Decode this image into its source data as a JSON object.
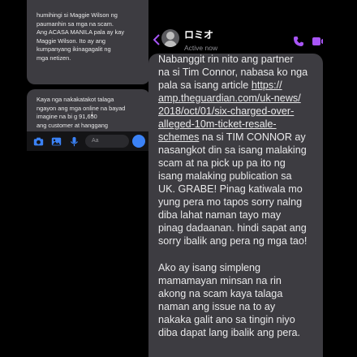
{
  "left_panel": {
    "message_top": "humihingi si Maggie Wilson ng\npaumanhin sa mga na scam.\nAng ACASA MANILA pala ay kay\nMaggie Wilson. Ito ay ang\nkumpanyang ikinagagalit ng\nmga netizen.",
    "message_bottom": "Kaya nga nakakatakot talaga\nngayon ang mga online na bayad\nimagine na bi    g 91,650\nang customer at hanggang",
    "composer_placeholder": "Aa"
  },
  "chat": {
    "contact_name": "ロミオ",
    "status": "Active now",
    "paragraph1_before_link": "Nabanggit rin nito ang partner\nna si Tim Connor, nabasa ko nga\npala sa isang article ",
    "paragraph1_link": "https://\namp.theguardian.com/uk-news/\n2018/oct/01/six-charged-over-\nalleged-10m-ticket-resale-\nschemes",
    "paragraph1_after_link": " na si TIM CONNOR ay\nnasangkot din sa isang malaking\nscam at na pick up pa ito ng\nisang malaking publication sa\nUK. GRABE! Pinag katiwala mo\nyung pera mo tapos sorry nalng\ndiba lahat naman tayo may\npinag dadaanan. hindi sapat ang\nsorry ibalik ang pera ng mga tao!",
    "paragraph2": "Ako ay isang simpleng\nmamamayan minsan na rin\nakong na scam kaya talaga\nnaman ang issue na to ay\nnakaka galit ano sa tingin niyo\ndiba dapat lang ibalik ang pera."
  },
  "colors": {
    "accent": "#a855f7",
    "composer_accent": "#3b82f6",
    "bubble": "#3d3c41",
    "background": "#000000"
  },
  "icons": [
    "camera-icon",
    "photo-icon",
    "microphone-icon",
    "emoji-icon",
    "scroll-down-icon",
    "back-icon",
    "phone-call-icon",
    "video-call-icon"
  ]
}
